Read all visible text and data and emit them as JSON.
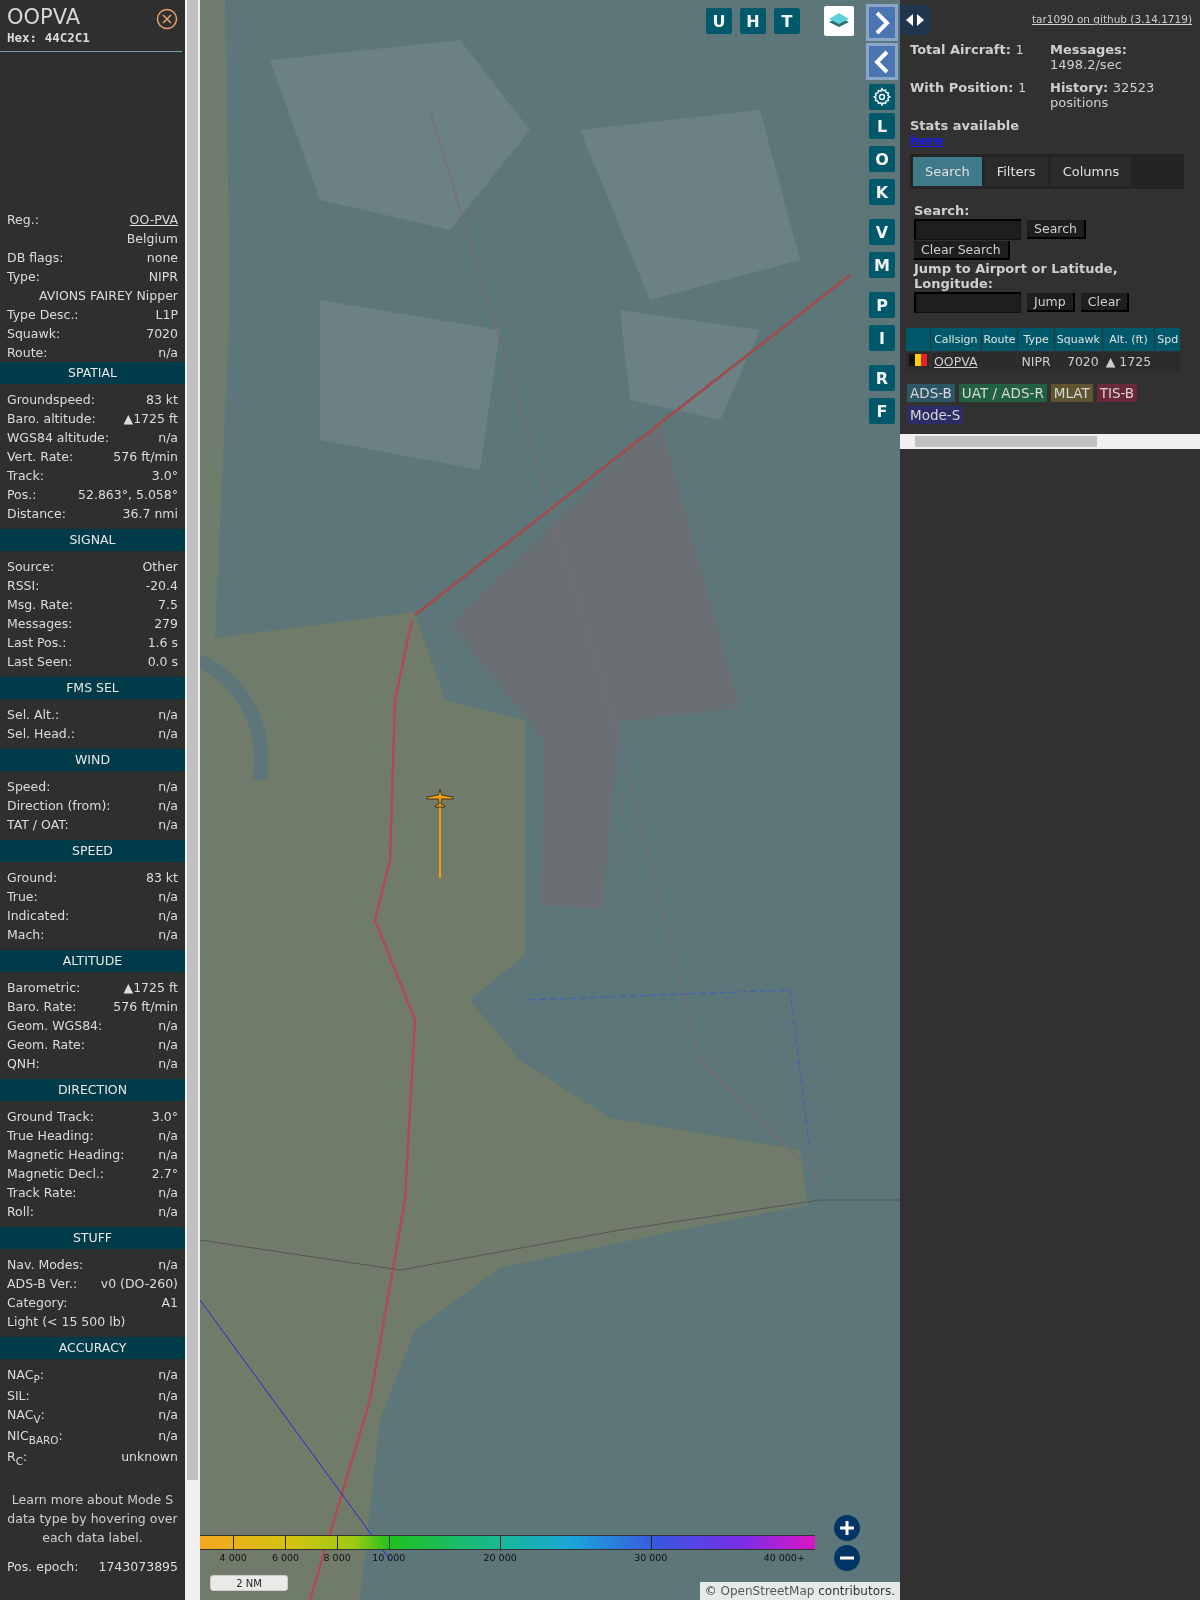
{
  "sidebar": {
    "title": "OOPVA",
    "hex": "Hex: 44C2C1",
    "info_rows": [
      {
        "kind": "link",
        "label": "Reg.:",
        "value": "OO-PVA"
      },
      {
        "kind": "value",
        "value": "Belgium"
      },
      {
        "kind": "pair",
        "label": "DB flags:",
        "value": "none"
      },
      {
        "kind": "pair",
        "label": "Type:",
        "value": "NIPR"
      },
      {
        "kind": "value",
        "value": "AVIONS FAIREY Nipper"
      },
      {
        "kind": "pair",
        "label": "Type Desc.:",
        "value": "L1P"
      },
      {
        "kind": "pair",
        "label": "Squawk:",
        "value": "7020"
      },
      {
        "kind": "pair",
        "label": "Route:",
        "value": "n/a"
      }
    ],
    "sections": [
      {
        "title": "SPATIAL",
        "rows": [
          {
            "kind": "pair",
            "label": "Groundspeed:",
            "value": "83 kt"
          },
          {
            "kind": "pair",
            "label": "Baro. altitude:",
            "value": "▲1725 ft"
          },
          {
            "kind": "pair",
            "label": "WGS84 altitude:",
            "value": "n/a"
          },
          {
            "kind": "pair",
            "label": "Vert. Rate:",
            "value": "576 ft/min"
          },
          {
            "kind": "pair",
            "label": "Track:",
            "value": "3.0°"
          },
          {
            "kind": "pair",
            "label": "Pos.:",
            "value": "52.863°, 5.058°"
          },
          {
            "kind": "pair",
            "label": "Distance:",
            "value": "36.7 nmi"
          }
        ]
      },
      {
        "title": "SIGNAL",
        "rows": [
          {
            "kind": "pair",
            "label": "Source:",
            "value": "Other"
          },
          {
            "kind": "pair",
            "label": "RSSI:",
            "value": "-20.4"
          },
          {
            "kind": "pair",
            "label": "Msg. Rate:",
            "value": "7.5"
          },
          {
            "kind": "pair",
            "label": "Messages:",
            "value": "279"
          },
          {
            "kind": "pair",
            "label": "Last Pos.:",
            "value": "1.6 s"
          },
          {
            "kind": "pair",
            "label": "Last Seen:",
            "value": "0.0 s"
          }
        ]
      },
      {
        "title": "FMS SEL",
        "rows": [
          {
            "kind": "pair",
            "label": "Sel. Alt.:",
            "value": "n/a"
          },
          {
            "kind": "pair",
            "label": "Sel. Head.:",
            "value": "n/a"
          }
        ]
      },
      {
        "title": "WIND",
        "rows": [
          {
            "kind": "pair",
            "label": "Speed:",
            "value": "n/a"
          },
          {
            "kind": "pair",
            "label": "Direction (from):",
            "value": "n/a"
          },
          {
            "kind": "pair",
            "label": "TAT / OAT:",
            "value": "n/a"
          }
        ]
      },
      {
        "title": "SPEED",
        "rows": [
          {
            "kind": "pair",
            "label": "Ground:",
            "value": "83 kt"
          },
          {
            "kind": "pair",
            "label": "True:",
            "value": "n/a"
          },
          {
            "kind": "pair",
            "label": "Indicated:",
            "value": "n/a"
          },
          {
            "kind": "pair",
            "label": "Mach:",
            "value": "n/a"
          }
        ]
      },
      {
        "title": "ALTITUDE",
        "rows": [
          {
            "kind": "pair",
            "label": "Barometric:",
            "value": "▲1725 ft"
          },
          {
            "kind": "pair",
            "label": "Baro. Rate:",
            "value": "576 ft/min"
          },
          {
            "kind": "pair",
            "label": "Geom. WGS84:",
            "value": "n/a"
          },
          {
            "kind": "pair",
            "label": "Geom. Rate:",
            "value": "n/a"
          },
          {
            "kind": "pair",
            "label": "QNH:",
            "value": "n/a"
          }
        ]
      },
      {
        "title": "DIRECTION",
        "rows": [
          {
            "kind": "pair",
            "label": "Ground Track:",
            "value": "3.0°"
          },
          {
            "kind": "pair",
            "label": "True Heading:",
            "value": "n/a"
          },
          {
            "kind": "pair",
            "label": "Magnetic Heading:",
            "value": "n/a"
          },
          {
            "kind": "pair",
            "label": "Magnetic Decl.:",
            "value": "2.7°"
          },
          {
            "kind": "pair",
            "label": "Track Rate:",
            "value": "n/a"
          },
          {
            "kind": "pair",
            "label": "Roll:",
            "value": "n/a"
          }
        ]
      },
      {
        "title": "STUFF",
        "rows": [
          {
            "kind": "pair",
            "label": "Nav. Modes:",
            "value": "n/a"
          },
          {
            "kind": "pair",
            "label": "ADS-B Ver.:",
            "value": "v0 (DO-260)"
          },
          {
            "kind": "pair",
            "label": "Category:",
            "value": "A1"
          },
          {
            "kind": "wide",
            "value": "Light (< 15 500 lb)"
          }
        ]
      },
      {
        "title": "ACCURACY",
        "rows": [
          {
            "kind": "pair",
            "label": "NAC$_{P}$:",
            "value": "n/a"
          },
          {
            "kind": "pair",
            "label": "SIL:",
            "value": "n/a"
          },
          {
            "kind": "pair",
            "label": "NAC$_{V}$:",
            "value": "n/a"
          },
          {
            "kind": "pair",
            "label": "NIC$_{BARO}$:",
            "value": "n/a"
          },
          {
            "kind": "pair",
            "label": "R$_{C}$:",
            "value": "unknown"
          }
        ]
      }
    ],
    "footnote": "Learn more about Mode S data type by hovering over each data label.",
    "last_row": {
      "label": "Pos. epoch:",
      "value": "1743073895"
    }
  },
  "map": {
    "top_buttons": [
      "U",
      "H",
      "T"
    ],
    "side_buttons": [
      {
        "kind": "next"
      },
      {
        "kind": "prev"
      },
      {
        "kind": "settings"
      },
      {
        "kind": "letter",
        "label": "L"
      },
      {
        "kind": "letter",
        "label": "O"
      },
      {
        "kind": "letter",
        "label": "K"
      },
      {
        "kind": "letter",
        "label": "V"
      },
      {
        "kind": "letter",
        "label": "M"
      },
      {
        "kind": "letter",
        "label": "P"
      },
      {
        "kind": "letter",
        "label": "I"
      },
      {
        "kind": "letter",
        "label": "R"
      },
      {
        "kind": "letter",
        "label": "F"
      }
    ],
    "altitude_legend": [
      "4 000",
      "6 000",
      "8 000",
      "10 000",
      "20 000",
      "30 000",
      "40 000+"
    ],
    "scale": "2 NM",
    "attribution": {
      "prefix": "© ",
      "link": "OpenStreetMap",
      "suffix": " contributors."
    }
  },
  "right_panel": {
    "github_link": "tar1090 on github (3.14.1719)",
    "stats": [
      {
        "label": "Total Aircraft:",
        "value": "1"
      },
      {
        "label": "Messages:",
        "value": "1498.2/sec"
      },
      {
        "label": "With Position:",
        "value": "1"
      },
      {
        "label": "History:",
        "value": "32523 positions"
      }
    ],
    "stats_note": "Stats available",
    "stats_link": "here",
    "tabs": [
      {
        "label": "Search",
        "selected": true
      },
      {
        "label": "Filters",
        "selected": false
      },
      {
        "label": "Columns",
        "selected": false
      }
    ],
    "search": {
      "label": "Search:",
      "button": "Search",
      "clear_button": "Clear Search"
    },
    "jump": {
      "label": "Jump to Airport or Latitude, Longitude:",
      "button": "Jump",
      "clear_button": "Clear"
    },
    "table": {
      "columns": [
        "Callsign",
        "Route",
        "Type",
        "Squawk",
        "Alt. (ft)",
        "Spd"
      ],
      "rows": [
        {
          "callsign": "OOPVA",
          "type": "NIPR",
          "squawk": "7020",
          "altitude": "▲ 1725"
        }
      ]
    },
    "source_tags": [
      {
        "label": "ADS-B",
        "color": "#2c5566"
      },
      {
        "label": "UAT / ADS-R",
        "color": "#22603f"
      },
      {
        "label": "MLAT",
        "color": "#5e5530"
      },
      {
        "label": "TIS-B",
        "color": "#6a2838"
      },
      {
        "label": "Mode-S",
        "color": "#2c2c66"
      }
    ]
  }
}
